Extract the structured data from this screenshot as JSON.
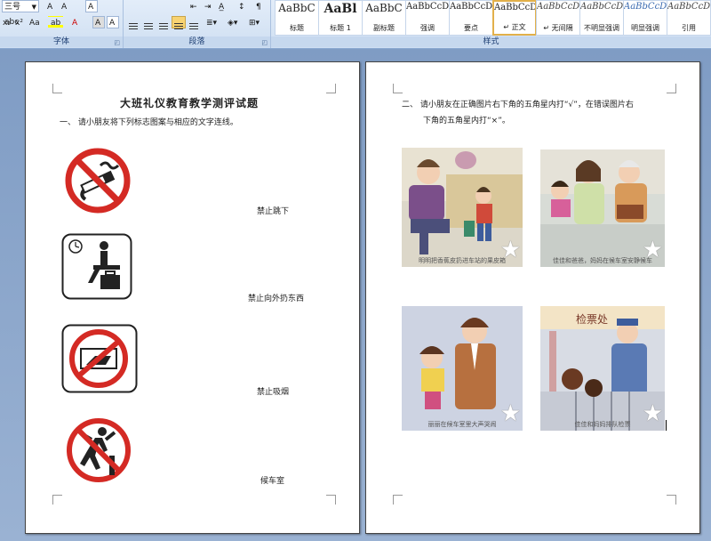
{
  "ribbon": {
    "font_group": {
      "label": "字体",
      "font_size": "三号",
      "row1": [
        "A",
        "A",
        "A"
      ],
      "row2_a": "Aa",
      "row2_b": "A",
      "row3": [
        "x₂",
        "x²",
        "Aa",
        "ab",
        "A",
        "A",
        "A"
      ]
    },
    "paragraph_group": {
      "label": "段落"
    },
    "styles_group": {
      "label": "样式",
      "tiles": [
        {
          "sample": "AaBbC",
          "name": "标题"
        },
        {
          "sample": "AaBl",
          "name": "标题 1"
        },
        {
          "sample": "AaBbC",
          "name": "副标题"
        },
        {
          "sample": "AaBbCcD",
          "name": "强调"
        },
        {
          "sample": "AaBbCcD",
          "name": "要点"
        },
        {
          "sample": "AaBbCcDc",
          "name": "↵ 正文"
        },
        {
          "sample": "AaBbCcDc",
          "name": "↵ 无间隔"
        },
        {
          "sample": "AaBbCcDc",
          "name": "不明显强调"
        },
        {
          "sample": "AaBbCcDc",
          "name": "明显强调"
        },
        {
          "sample": "AaBbCcDc",
          "name": "引用"
        }
      ]
    }
  },
  "page1": {
    "title": "大班礼仪教育教学测评试题",
    "question": "一、 请小朋友将下列标志图案与相应的文字连线。",
    "labels": [
      "禁止跳下",
      "禁止向外扔东西",
      "禁止吸烟",
      "候车室"
    ],
    "icons": [
      "no-smoking-icon",
      "waiting-room-icon",
      "no-throwing-icon",
      "no-jumping-icon"
    ]
  },
  "page2": {
    "question_line1": "二、 请小朋友在正确图片右下角的五角星内打“√”，在错误图片右",
    "question_line2": "下角的五角星内打“×”。",
    "photos": [
      {
        "caption": "明明把香蕉皮扔进车站的果皮箱"
      },
      {
        "caption": "佳佳和爸爸，妈妈在候车室安静候车"
      },
      {
        "caption": "丽丽在候车室里大声哭闹"
      },
      {
        "caption": "佳佳和妈妈排队检票",
        "sign": "检票处"
      }
    ]
  },
  "colors": {
    "ribbon_top": "#e3edf9",
    "workspace": "#7f9cc4",
    "sign_red": "#d42a24",
    "style_selected": "#e2b04a"
  }
}
